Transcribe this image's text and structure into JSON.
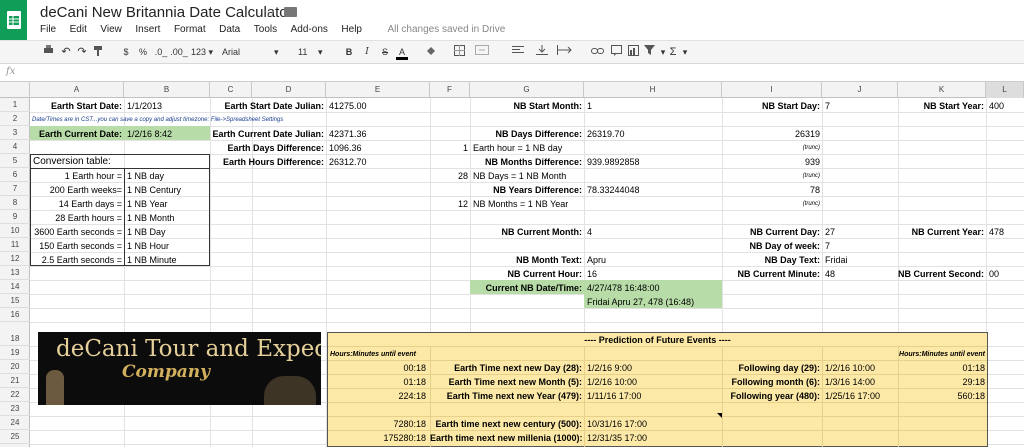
{
  "app": {
    "title": "deCani New Britannia Date Calculator",
    "menu": [
      "File",
      "Edit",
      "View",
      "Insert",
      "Format",
      "Data",
      "Tools",
      "Add-ons",
      "Help"
    ],
    "save_status": "All changes saved in Drive",
    "fx_label": "fx"
  },
  "toolbar": {
    "currency": "$",
    "percent": "%",
    "dec_minus": ".0_",
    "dec_plus": ".00_",
    "more_formats": "123",
    "font": "Arial",
    "size": "11",
    "bold": "B",
    "italic": "I",
    "strike": "S",
    "text_color": "A",
    "sigma": "Σ"
  },
  "columns": [
    "A",
    "B",
    "C",
    "D",
    "E",
    "F",
    "G",
    "H",
    "I",
    "J",
    "K",
    "L"
  ],
  "rows": [
    "1",
    "2",
    "3",
    "4",
    "5",
    "6",
    "7",
    "8",
    "9",
    "10",
    "11",
    "12",
    "13",
    "14",
    "15",
    "16",
    "18",
    "19",
    "20",
    "21",
    "22",
    "23",
    "24",
    "25"
  ],
  "cells": {
    "a1": "Earth Start Date:",
    "b1": "1/1/2013",
    "d1": "Earth Start Date Julian:",
    "e1": "41275.00",
    "g1": "NB Start Month:",
    "h1": "1",
    "i1": "NB Start Day:",
    "j1": "7",
    "k1": "NB Start Year:",
    "l1": "400",
    "a2": "Date/Times are in CST...you can save a copy and adjust timezone: File->Spreadsheet Settings",
    "a3": "Earth Current Date:",
    "b3": "1/2/16 8:42",
    "d3": "Earth Current Date Julian:",
    "e3": "42371.36",
    "g3": "NB Days Difference:",
    "h3": "26319.70",
    "i3": "26319",
    "d4": "Earth Days Difference:",
    "e4": "1096.36",
    "f4": "1",
    "g4": "Earth hour = 1 NB day",
    "i4": "(trunc)",
    "a5": "Conversion table:",
    "d5": "Earth Hours Difference:",
    "e5": "26312.70",
    "g5": "NB Months Difference:",
    "h5": "939.9892858",
    "i5": "939",
    "a6": "1 Earth hour =",
    "b6": "1 NB day",
    "f6": "28",
    "g6": "NB Days = 1 NB Month",
    "i6": "(trunc)",
    "a7": "200 Earth weeks=",
    "b7": "1 NB Century",
    "g7": "NB Years Difference:",
    "h7": "78.33244048",
    "i7": "78",
    "a8": "14 Earth days =",
    "b8": "1 NB Year",
    "f8": "12",
    "g8": "NB Months = 1 NB Year",
    "i8": "(trunc)",
    "a9": "28 Earth hours =",
    "b9": "1 NB Month",
    "a10": "3600 Earth seconds =",
    "b10": "1 NB Day",
    "g10": "NB Current Month:",
    "h10": "4",
    "i10": "NB Current Day:",
    "j10": "27",
    "k10": "NB Current Year:",
    "l10": "478",
    "a11": "150 Earth seconds =",
    "b11": "1 NB Hour",
    "i11": "NB Day of week:",
    "j11": "7",
    "a12": "2.5 Earth seconds =",
    "b12": "1 NB Minute",
    "g12": "NB Month Text:",
    "h12": "Apru",
    "i12": "NB Day Text:",
    "j12": "Fridai",
    "g13": "NB Current Hour:",
    "h13": "16",
    "i13": "NB Current Minute:",
    "j13": "48",
    "k13": "NB Current Second:",
    "l13": "00",
    "g14": "Current NB Date/Time:",
    "h14": "4/27/478 16:48:00",
    "h15": "Fridai Apru 27, 478 (16:48)"
  },
  "banner": {
    "line1": "deCani Tour and Expedition",
    "line2": "Company"
  },
  "prediction": {
    "title": "---- Prediction of Future Events ----",
    "hours_label_left": "Hours:Minutes until event",
    "hours_label_right": "Hours:Minutes until event",
    "rows": [
      {
        "left_val": "00:18",
        "label": "Earth Time next new Day (28):",
        "date": "1/2/16 9:00",
        "rlabel": "Following day (29):",
        "rdate": "1/2/16 10:00",
        "rval": "01:18"
      },
      {
        "left_val": "01:18",
        "label": "Earth Time next new Month (5):",
        "date": "1/2/16 10:00",
        "rlabel": "Following month (6):",
        "rdate": "1/3/16 14:00",
        "rval": "29:18"
      },
      {
        "left_val": "224:18",
        "label": "Earth Time next new Year (479):",
        "date": "1/11/16 17:00",
        "rlabel": "Following year (480):",
        "rdate": "1/25/16 17:00",
        "rval": "560:18"
      },
      {
        "left_val": "7280:18",
        "label": "Earth time next new century (500):",
        "date": "10/31/16 17:00"
      },
      {
        "left_val": "175280:18",
        "label": "Earth time next new millenia (1000):",
        "date": "12/31/35 17:00"
      }
    ]
  },
  "colors": {
    "sheets_green": "#0f9d58",
    "highlight_green": "#b7dca8",
    "prediction_yellow": "#fde9a7"
  }
}
